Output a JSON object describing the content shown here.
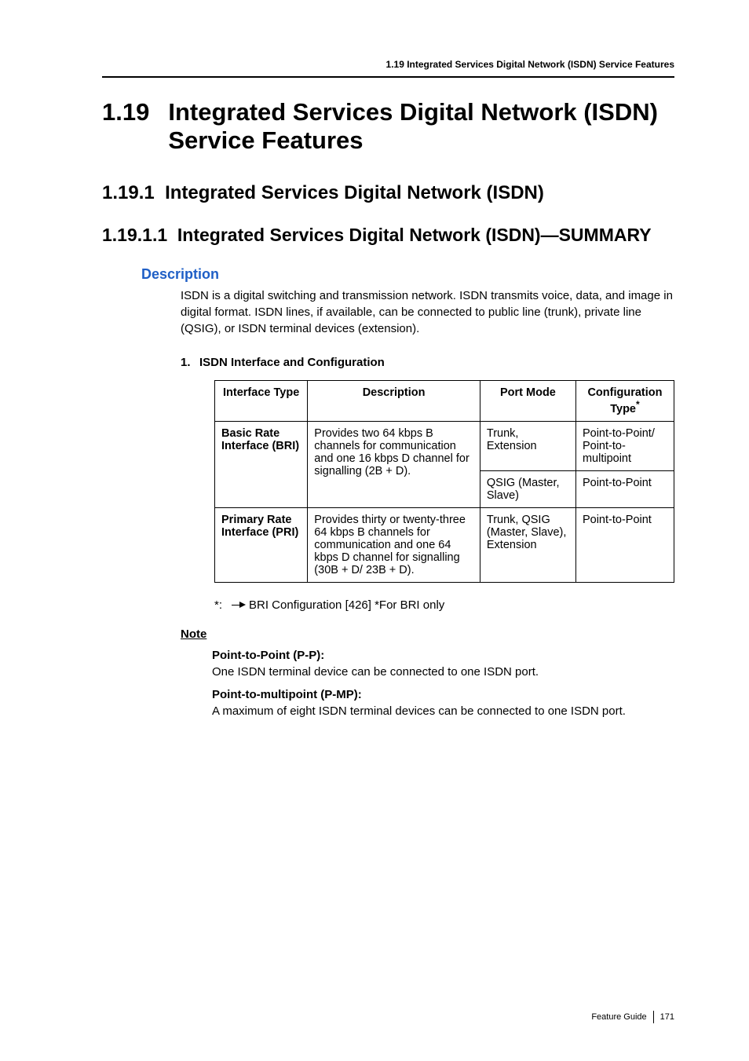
{
  "running_head": "1.19 Integrated Services Digital Network (ISDN) Service Features",
  "section": {
    "number": "1.19",
    "title_line1": "Integrated Services Digital Network (ISDN)",
    "title_line2": "Service Features"
  },
  "subsection": {
    "number": "1.19.1",
    "title": "Integrated Services Digital Network (ISDN)"
  },
  "subsubsection": {
    "number": "1.19.1.1",
    "title": "Integrated Services Digital Network (ISDN)—SUMMARY"
  },
  "description_head": "Description",
  "description_body": "ISDN is a digital switching and transmission network. ISDN transmits voice, data, and image in digital format. ISDN lines, if available, can be connected to public line (trunk), private line (QSIG), or ISDN terminal devices (extension).",
  "numbered_item": {
    "num": "1.",
    "text": "ISDN Interface and Configuration"
  },
  "table": {
    "headers": {
      "iface": "Interface Type",
      "desc": "Description",
      "port": "Port Mode",
      "conf": "Configuration Type",
      "conf_super": "*"
    },
    "rows": [
      {
        "iface": "Basic Rate Interface (BRI)",
        "desc": "Provides two 64 kbps B channels for communication and one 16 kbps D channel for signalling (2B + D).",
        "sub": [
          {
            "port": "Trunk, Extension",
            "conf": "Point-to-Point/ Point-to-multipoint"
          },
          {
            "port": "QSIG (Master, Slave)",
            "conf": "Point-to-Point"
          }
        ]
      },
      {
        "iface": "Primary Rate Interface (PRI)",
        "desc": "Provides thirty or twenty-three 64 kbps B channels for communication and one 64 kbps D channel for signalling (30B + D/ 23B + D).",
        "port": "Trunk, QSIG (Master, Slave), Extension",
        "conf": "Point-to-Point"
      }
    ]
  },
  "footnote": {
    "marker": "*:",
    "text": "BRI Configuration [426] *For BRI only"
  },
  "note": {
    "head": "Note",
    "items": [
      {
        "head": "Point-to-Point (P-P):",
        "body": "One ISDN terminal device can be connected to one ISDN port."
      },
      {
        "head": "Point-to-multipoint (P-MP):",
        "body": "A maximum of eight ISDN terminal devices can be connected to one ISDN port."
      }
    ]
  },
  "footer": {
    "label": "Feature Guide",
    "page": "171"
  }
}
